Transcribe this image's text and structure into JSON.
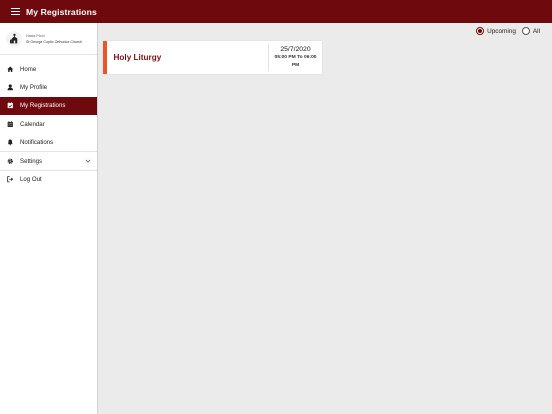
{
  "header": {
    "title": "My Registrations",
    "menu_icon": "hamburger-icon"
  },
  "profile": {
    "name": "Hasta Ptoni",
    "church": "St George Coptic Orthodox Church",
    "icon": "church-logo-icon"
  },
  "sidebar": {
    "items": [
      {
        "label": "Home",
        "icon": "home-icon"
      },
      {
        "label": "My Profile",
        "icon": "user-icon"
      },
      {
        "label": "My Registrations",
        "icon": "calendar-check-icon",
        "active": true
      },
      {
        "label": "Calendar",
        "icon": "calendar-icon"
      },
      {
        "label": "Notifications",
        "icon": "bell-icon"
      },
      {
        "label": "Settings",
        "icon": "gear-icon"
      },
      {
        "label": "Log Out",
        "icon": "logout-icon"
      }
    ]
  },
  "filter": {
    "upcoming": "Upcoming",
    "all": "All",
    "selected": "Upcoming"
  },
  "registrations": [
    {
      "title": "Holy Liturgy",
      "date": "25/7/2020",
      "time": "05:00 PM To 06:00 PM"
    }
  ],
  "colors": {
    "brand": "#6e0a0e",
    "accent": "#e9562b",
    "background": "#ebebeb"
  }
}
